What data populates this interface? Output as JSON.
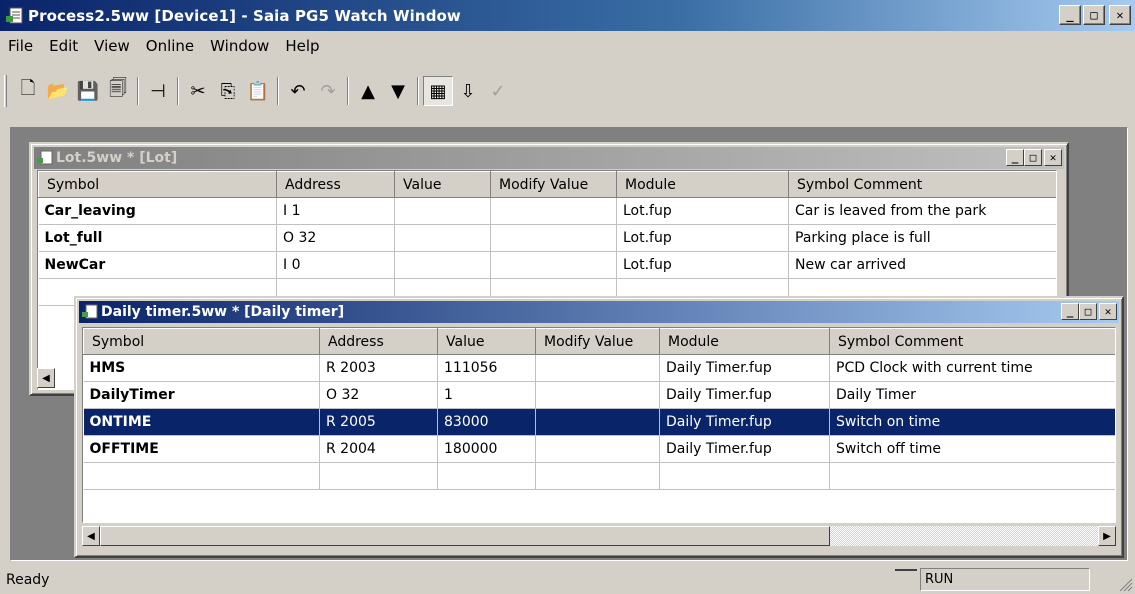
{
  "app": {
    "title": "Process2.5ww [Device1] - Saia PG5 Watch Window",
    "menu": [
      "File",
      "Edit",
      "View",
      "Online",
      "Window",
      "Help"
    ],
    "status": "Ready",
    "status_mode": "RUN"
  },
  "toolbar": {
    "buttons": [
      {
        "name": "new-icon",
        "glyph": "🗋"
      },
      {
        "name": "open-icon",
        "glyph": "📂"
      },
      {
        "name": "save-icon",
        "glyph": "💾"
      },
      {
        "name": "save-all-icon",
        "glyph": "🗐"
      },
      {
        "name": "pin-icon",
        "glyph": "⊣"
      },
      {
        "name": "cut-icon",
        "glyph": "✂"
      },
      {
        "name": "copy-icon",
        "glyph": "⎘"
      },
      {
        "name": "paste-icon",
        "glyph": "📋"
      },
      {
        "name": "undo-icon",
        "glyph": "↶"
      },
      {
        "name": "redo-icon",
        "glyph": "↷"
      },
      {
        "name": "move-up-icon",
        "glyph": "▲"
      },
      {
        "name": "move-down-icon",
        "glyph": "▼"
      },
      {
        "name": "watch-icon",
        "glyph": "▦"
      },
      {
        "name": "download-icon",
        "glyph": "⇩"
      },
      {
        "name": "check-icon",
        "glyph": "✓"
      }
    ]
  },
  "lot_window": {
    "title": "Lot.5ww * [Lot]",
    "columns": [
      "Symbol",
      "Address",
      "Value",
      "Modify Value",
      "Module",
      "Symbol Comment"
    ],
    "rows": [
      {
        "symbol": "Car_leaving",
        "address": "I 1",
        "value": "",
        "modify": "",
        "module": "Lot.fup",
        "comment": "Car is leaved from the park"
      },
      {
        "symbol": "Lot_full",
        "address": "O 32",
        "value": "",
        "modify": "",
        "module": "Lot.fup",
        "comment": "Parking place is full"
      },
      {
        "symbol": "NewCar",
        "address": "I 0",
        "value": "",
        "modify": "",
        "module": "Lot.fup",
        "comment": "New car arrived"
      }
    ]
  },
  "timer_window": {
    "title": "Daily timer.5ww * [Daily timer]",
    "columns": [
      "Symbol",
      "Address",
      "Value",
      "Modify Value",
      "Module",
      "Symbol Comment"
    ],
    "rows": [
      {
        "symbol": "HMS",
        "address": "R 2003",
        "value": "111056",
        "modify": "",
        "module": "Daily Timer.fup",
        "comment": "PCD Clock with current time"
      },
      {
        "symbol": "DailyTimer",
        "address": "O 32",
        "value": "1",
        "modify": "",
        "module": "Daily Timer.fup",
        "comment": "Daily Timer"
      },
      {
        "symbol": "ONTIME",
        "address": "R 2005",
        "value": "83000",
        "modify": "",
        "module": "Daily Timer.fup",
        "comment": "Switch on time"
      },
      {
        "symbol": "OFFTIME",
        "address": "R 2004",
        "value": "180000",
        "modify": "",
        "module": "Daily Timer.fup",
        "comment": "Switch off time"
      }
    ],
    "selected_symbol": "ONTIME"
  },
  "colors": {
    "selection": "#0a246a",
    "title_active": "#0a246a",
    "face": "#d4d0c8"
  }
}
